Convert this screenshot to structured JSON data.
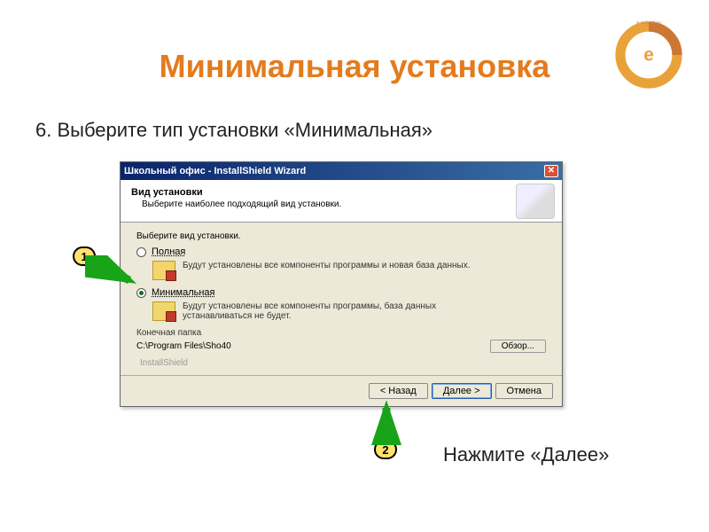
{
  "slide": {
    "title": "Минимальная установка",
    "step_text": "6. Выберите тип установки «Минимальная»",
    "action_text": "Нажмите «Далее»"
  },
  "badges": {
    "one": "1",
    "two": "2"
  },
  "wizard": {
    "title": "Школьный офис - InstallShield Wizard",
    "header_title": "Вид установки",
    "header_sub": "Выберите наиболее подходящий вид установки.",
    "select_label": "Выберите вид установки.",
    "opt_full": {
      "label": "Полная",
      "desc": "Будут установлены все компоненты программы и новая база данных."
    },
    "opt_min": {
      "label": "Минимальная",
      "desc": "Будут установлены все компоненты программы, база данных устанавливаться не будет."
    },
    "dest_label": "Конечная папка",
    "dest_path": "C:\\Program Files\\Sho40",
    "browse": "Обзор...",
    "brand": "InstallShield",
    "btn_back": "< Назад",
    "btn_next": "Далее >",
    "btn_cancel": "Отмена"
  },
  "logo_text": "e-school.ru"
}
